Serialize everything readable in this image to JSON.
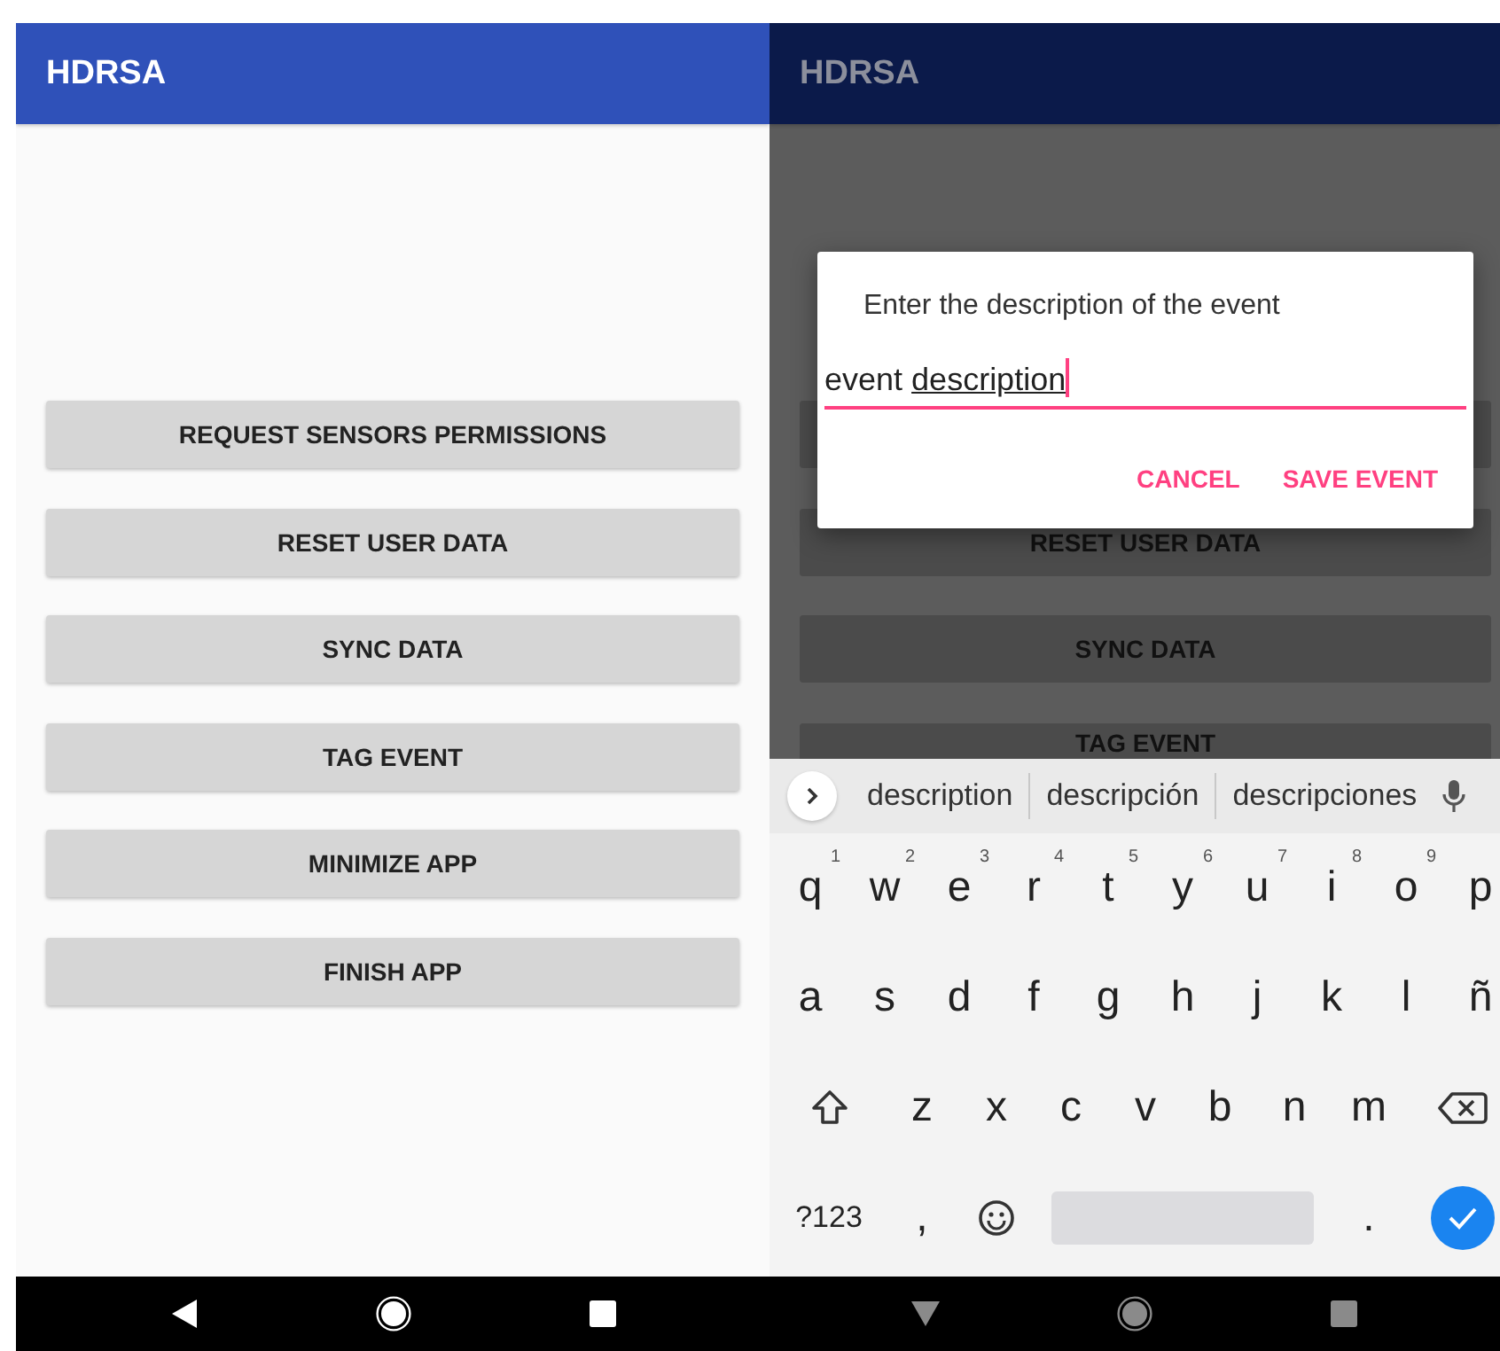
{
  "screens": [
    {
      "dimmed": false,
      "app_bar": {
        "title": "HDRSA"
      },
      "buttons": [
        {
          "label": "REQUEST SENSORS PERMISSIONS"
        },
        {
          "label": "RESET USER DATA"
        },
        {
          "label": "SYNC DATA"
        },
        {
          "label": "TAG EVENT"
        },
        {
          "label": "MINIMIZE APP"
        },
        {
          "label": "FINISH APP"
        }
      ],
      "nav_bar": [
        {
          "kind": "back"
        },
        {
          "kind": "home"
        },
        {
          "kind": "recents"
        }
      ]
    },
    {
      "dimmed": true,
      "app_bar": {
        "title": "HDRSA"
      },
      "buttons": [
        {
          "covered": true
        },
        {
          "label": "RESET USER DATA"
        },
        {
          "label": "SYNC DATA"
        },
        {
          "label": "TAG EVENT"
        }
      ],
      "dialog": {
        "message": "Enter the description of the event",
        "field": {
          "parts": [
            {
              "text": "event",
              "composing": false
            },
            {
              "text": "description",
              "composing": true
            }
          ]
        },
        "actions": [
          "CANCEL",
          "SAVE EVENT"
        ]
      },
      "keyboard": {
        "suggestions": [
          "description",
          "descripción",
          "descripciones"
        ],
        "rows": [
          [
            {
              "kind": "letter",
              "label": "q",
              "hint": "1"
            },
            {
              "kind": "letter",
              "label": "w",
              "hint": "2"
            },
            {
              "kind": "letter",
              "label": "e",
              "hint": "3"
            },
            {
              "kind": "letter",
              "label": "r",
              "hint": "4"
            },
            {
              "kind": "letter",
              "label": "t",
              "hint": "5"
            },
            {
              "kind": "letter",
              "label": "y",
              "hint": "6"
            },
            {
              "kind": "letter",
              "label": "u",
              "hint": "7"
            },
            {
              "kind": "letter",
              "label": "i",
              "hint": "8"
            },
            {
              "kind": "letter",
              "label": "o",
              "hint": "9"
            },
            {
              "kind": "letter",
              "label": "p"
            }
          ],
          [
            {
              "kind": "letter",
              "label": "a"
            },
            {
              "kind": "letter",
              "label": "s"
            },
            {
              "kind": "letter",
              "label": "d"
            },
            {
              "kind": "letter",
              "label": "f"
            },
            {
              "kind": "letter",
              "label": "g"
            },
            {
              "kind": "letter",
              "label": "h"
            },
            {
              "kind": "letter",
              "label": "j"
            },
            {
              "kind": "letter",
              "label": "k"
            },
            {
              "kind": "letter",
              "label": "l"
            },
            {
              "kind": "letter",
              "label": "ñ"
            }
          ],
          [
            {
              "kind": "shift"
            },
            {
              "kind": "letter",
              "label": "z"
            },
            {
              "kind": "letter",
              "label": "x"
            },
            {
              "kind": "letter",
              "label": "c"
            },
            {
              "kind": "letter",
              "label": "v"
            },
            {
              "kind": "letter",
              "label": "b"
            },
            {
              "kind": "letter",
              "label": "n"
            },
            {
              "kind": "letter",
              "label": "m"
            },
            {
              "kind": "backspace"
            }
          ],
          [
            {
              "kind": "symbols",
              "label": "?123"
            },
            {
              "kind": "letter",
              "label": ","
            },
            {
              "kind": "emoji"
            },
            {
              "kind": "space"
            },
            {
              "kind": "letter",
              "label": "."
            },
            {
              "kind": "enter"
            }
          ]
        ]
      },
      "nav_bar": [
        {
          "kind": "hide_keyboard"
        },
        {
          "kind": "home"
        },
        {
          "kind": "recents"
        }
      ]
    }
  ]
}
